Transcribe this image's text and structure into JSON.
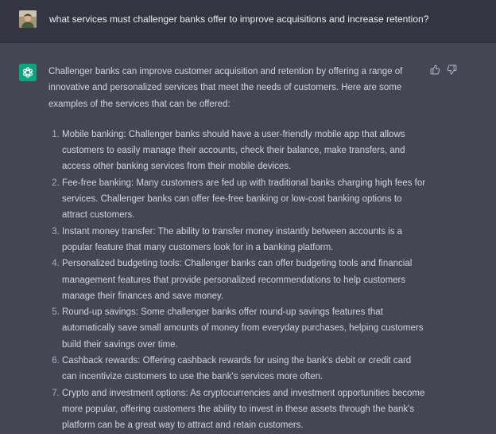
{
  "user": {
    "message": "what services must challenger banks offer to improve acquisitions and increase retention?"
  },
  "assistant": {
    "intro": "Challenger banks can improve customer acquisition and retention by offering a range of innovative and personalized services that meet the needs of customers. Here are some examples of the services that can be offered:",
    "items": [
      "Mobile banking: Challenger banks should have a user-friendly mobile app that allows customers to easily manage their accounts, check their balance, make transfers, and access other banking services from their mobile devices.",
      "Fee-free banking: Many customers are fed up with traditional banks charging high fees for services. Challenger banks can offer fee-free banking or low-cost banking options to attract customers.",
      "Instant money transfer: The ability to transfer money instantly between accounts is a popular feature that many customers look for in a banking platform.",
      "Personalized budgeting tools: Challenger banks can offer budgeting tools and financial management features that provide personalized recommendations to help customers manage their finances and save money.",
      "Round-up savings: Some challenger banks offer round-up savings features that automatically save small amounts of money from everyday purchases, helping customers build their savings over time.",
      "Cashback rewards: Offering cashback rewards for using the bank's debit or credit card can incentivize customers to use the bank's services more often.",
      "Crypto and investment options: As cryptocurrencies and investment opportunities become more popular, offering customers the ability to invest in these assets through the bank's platform can be a great way to attract and retain customers."
    ]
  },
  "icons": {
    "user_avatar": "user-avatar-photo",
    "bot_avatar": "openai-logo-icon",
    "thumbs_up": "thumbs-up-icon",
    "thumbs_down": "thumbs-down-icon"
  },
  "colors": {
    "user_bg": "#343541",
    "assistant_bg": "#444654",
    "bot_avatar_bg": "#10a37f",
    "text": "#d1d5db"
  }
}
